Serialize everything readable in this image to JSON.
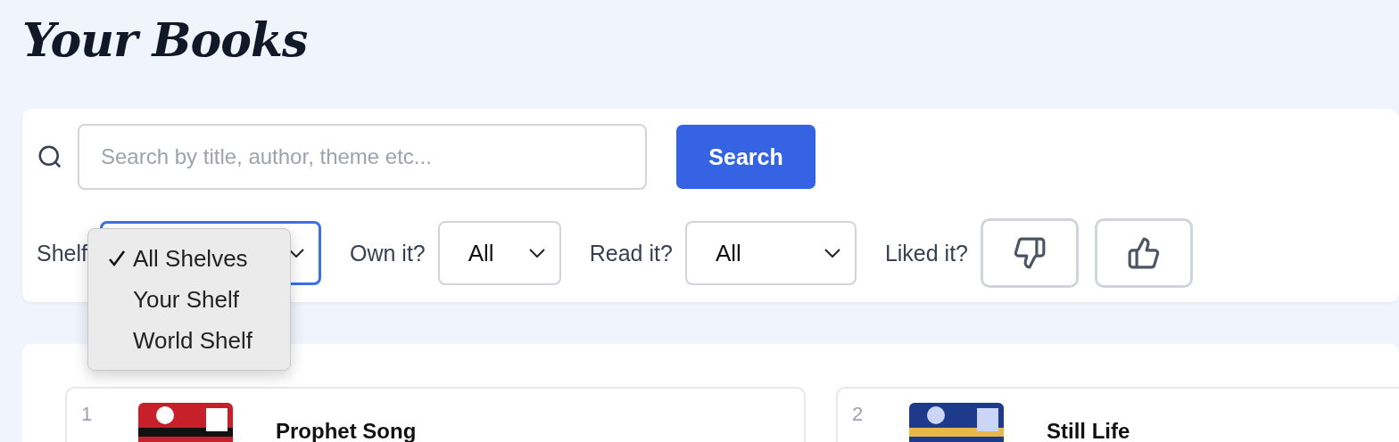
{
  "heading": "Your Books",
  "search": {
    "placeholder": "Search by title, author, theme etc...",
    "button": "Search"
  },
  "filters": {
    "shelf": {
      "label": "Shelf",
      "focused": true,
      "options": [
        {
          "label": "All Shelves",
          "selected": true
        },
        {
          "label": "Your Shelf",
          "selected": false
        },
        {
          "label": "World Shelf",
          "selected": false
        }
      ]
    },
    "own": {
      "label": "Own it?",
      "value": "All"
    },
    "read": {
      "label": "Read it?",
      "value": "All"
    },
    "liked": {
      "label": "Liked it?"
    }
  },
  "books": [
    {
      "number": "1",
      "title": "Prophet Song"
    },
    {
      "number": "2",
      "title": "Still Life"
    }
  ]
}
